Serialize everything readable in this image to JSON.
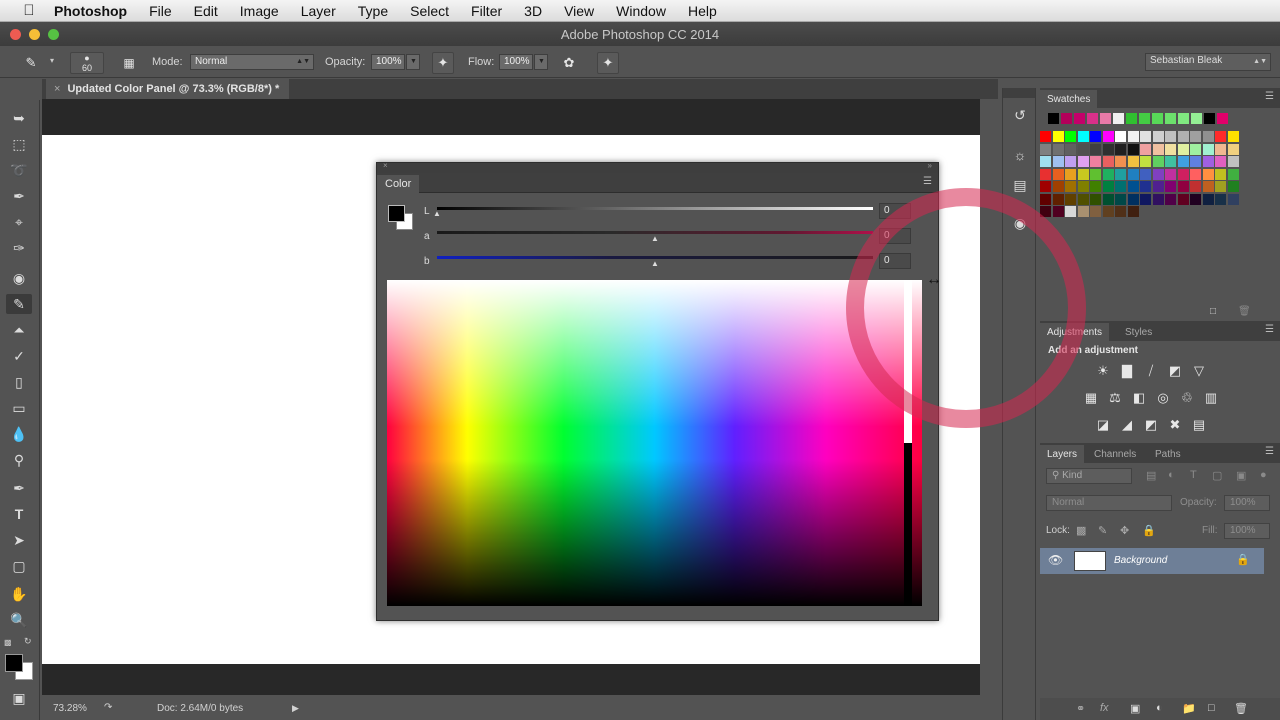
{
  "menubar": {
    "app_name": "Photoshop",
    "items": [
      "File",
      "Edit",
      "Image",
      "Layer",
      "Type",
      "Select",
      "Filter",
      "3D",
      "View",
      "Window",
      "Help"
    ]
  },
  "window": {
    "title": "Adobe Photoshop CC 2014"
  },
  "options": {
    "brush_size": "60",
    "mode_label": "Mode:",
    "mode_value": "Normal",
    "opacity_label": "Opacity:",
    "opacity_value": "100%",
    "flow_label": "Flow:",
    "flow_value": "100%",
    "user_name": "Sebastian Bleak"
  },
  "document": {
    "tab_title": "Updated Color Panel @ 73.3% (RGB/8*) *",
    "zoom": "73.28%",
    "doc_size": "Doc: 2.64M/0 bytes"
  },
  "color_panel": {
    "tab_label": "Color",
    "sliders": [
      {
        "label": "L",
        "value": "0",
        "thumb_level": 0
      },
      {
        "label": "a",
        "value": "0",
        "thumb_level": 0.5
      },
      {
        "label": "b",
        "value": "0",
        "thumb_level": 0.5
      }
    ],
    "foreground_color": "#000000",
    "background_color": "#ffffff"
  },
  "swatches": {
    "tab_label": "Swatches",
    "top_row": [
      "#000000",
      "#b3005a",
      "#c4006a",
      "#d8308a",
      "#e87aa8",
      "#f0f0f0",
      "#30c030",
      "#44cc44",
      "#58d858",
      "#6ce06c",
      "#80e880",
      "#94ee94",
      "#000000",
      "#e0006a"
    ],
    "rows": [
      [
        "#ff0000",
        "#ffff00",
        "#00ff00",
        "#00ffff",
        "#0000ff",
        "#ff00ff",
        "#ffffff",
        "#f0f0f0",
        "#e0e0e0",
        "#d0d0d0",
        "#c0c0c0",
        "#b0b0b0",
        "#a0a0a0",
        "#909090",
        "#ff2a2a",
        "#ffe000"
      ],
      [
        "#808080",
        "#707070",
        "#606060",
        "#505050",
        "#404040",
        "#303030",
        "#202020",
        "#101010",
        "#f0a0a0",
        "#f0c0a0",
        "#f0e0a0",
        "#e0f0a0",
        "#a0f0a0",
        "#a0f0d0",
        "#f0b890",
        "#f0d080"
      ],
      [
        "#a0e0f0",
        "#a0c0f0",
        "#c0a0f0",
        "#e0a0f0",
        "#f080a0",
        "#e86060",
        "#f09050",
        "#f0c040",
        "#c0e040",
        "#60d060",
        "#40c0a0",
        "#40a0e0",
        "#6080e0",
        "#a060e0",
        "#e060c0",
        "#c0c0c0"
      ],
      [
        "#e83030",
        "#e86020",
        "#e8a020",
        "#c8c820",
        "#60c030",
        "#20b060",
        "#20a0a0",
        "#2080c0",
        "#4060c0",
        "#8040c0",
        "#c030a0",
        "#d02060",
        "#ff6060",
        "#ff9040",
        "#c0c020",
        "#40b040"
      ],
      [
        "#a00000",
        "#a04000",
        "#a07000",
        "#808000",
        "#408000",
        "#008040",
        "#007070",
        "#005090",
        "#203090",
        "#502090",
        "#800070",
        "#900040",
        "#c03030",
        "#c06020",
        "#a0a020",
        "#208020"
      ],
      [
        "#600000",
        "#602000",
        "#604000",
        "#505000",
        "#305000",
        "#005030",
        "#004848",
        "#003060",
        "#101860",
        "#301060",
        "#500048",
        "#600020",
        "#200020",
        "#102040",
        "#183048",
        "#304060"
      ],
      [
        "#400010",
        "#500020",
        "#d8d8d8",
        "#a89070",
        "#806040",
        "#604020",
        "#503018",
        "#402010"
      ]
    ]
  },
  "adjustments": {
    "tab_label": "Adjustments",
    "styles_tab": "Styles",
    "heading": "Add an adjustment",
    "icons": [
      [
        "brightness-icon",
        "levels-icon",
        "curves-icon",
        "exposure-icon",
        "vibrance-icon"
      ],
      [
        "hue-saturation-icon",
        "color-balance-icon",
        "black-white-icon",
        "photo-filter-icon",
        "channel-mixer-icon",
        "color-lookup-icon"
      ],
      [
        "invert-icon",
        "posterize-icon",
        "threshold-icon",
        "selective-color-icon",
        "gradient-map-icon"
      ]
    ]
  },
  "layers": {
    "tabs": [
      "Layers",
      "Channels",
      "Paths"
    ],
    "filter_kind": "Kind",
    "blend_mode": "Normal",
    "opacity_label": "Opacity:",
    "opacity_value": "100%",
    "lock_label": "Lock:",
    "fill_label": "Fill:",
    "fill_value": "100%",
    "items": [
      {
        "name": "Background"
      }
    ]
  }
}
